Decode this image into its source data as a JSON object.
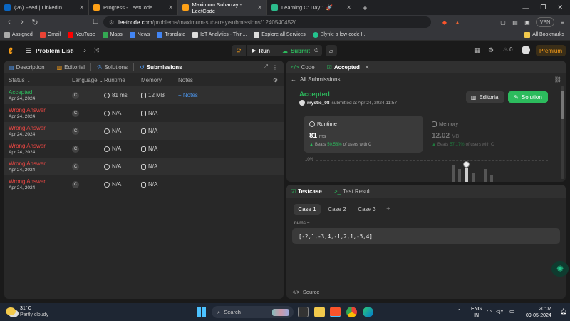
{
  "browser": {
    "tabs": [
      {
        "title": "(26) Feed | LinkedIn",
        "color": "#0a66c2"
      },
      {
        "title": "Progress - LeetCode",
        "color": "#ffa116"
      },
      {
        "title": "Maximum Subarray - LeetCode",
        "color": "#ffa116",
        "active": true
      },
      {
        "title": "Learning C: Day 1 🚀",
        "color": "#2cbb8c"
      }
    ],
    "url_host": "leetcode.com",
    "url_path": "/problems/maximum-subarray/submissions/1240540452/",
    "vpn_label": "VPN",
    "bookmarks": [
      {
        "label": "Assigned",
        "color": "#aaa"
      },
      {
        "label": "Gmail",
        "color": "#ea4335"
      },
      {
        "label": "YouTube",
        "color": "#ff0000"
      },
      {
        "label": "Maps",
        "color": "#34a853"
      },
      {
        "label": "News",
        "color": "#4285f4"
      },
      {
        "label": "Translate",
        "color": "#4285f4"
      },
      {
        "label": "IoT Analytics - Thin...",
        "color": "#ddd"
      },
      {
        "label": "Explore all Services",
        "color": "#ddd"
      },
      {
        "label": "Blynk: a low-code I...",
        "color": "#23c48e"
      }
    ],
    "all_bookmarks": "All Bookmarks"
  },
  "lc_header": {
    "problem_list": "Problem List",
    "run": "Run",
    "submit": "Submit",
    "streak": "0",
    "premium": "Premium"
  },
  "left_panel": {
    "tabs": [
      "Description",
      "Editorial",
      "Solutions",
      "Submissions"
    ],
    "columns": [
      "Status",
      "Language",
      "Runtime",
      "Memory",
      "Notes"
    ],
    "rows": [
      {
        "status": "Accepted",
        "date": "Apr 24, 2024",
        "lang": "C",
        "runtime": "81 ms",
        "memory": "12 MB",
        "notes": "+ Notes",
        "ok": true
      },
      {
        "status": "Wrong Answer",
        "date": "Apr 24, 2024",
        "lang": "C",
        "runtime": "N/A",
        "memory": "N/A",
        "notes": "",
        "ok": false
      },
      {
        "status": "Wrong Answer",
        "date": "Apr 24, 2024",
        "lang": "C",
        "runtime": "N/A",
        "memory": "N/A",
        "notes": "",
        "ok": false
      },
      {
        "status": "Wrong Answer",
        "date": "Apr 24, 2024",
        "lang": "C",
        "runtime": "N/A",
        "memory": "N/A",
        "notes": "",
        "ok": false
      },
      {
        "status": "Wrong Answer",
        "date": "Apr 24, 2024",
        "lang": "C",
        "runtime": "N/A",
        "memory": "N/A",
        "notes": "",
        "ok": false
      },
      {
        "status": "Wrong Answer",
        "date": "Apr 24, 2024",
        "lang": "C",
        "runtime": "N/A",
        "memory": "N/A",
        "notes": "",
        "ok": false
      }
    ]
  },
  "right_top": {
    "tab_code": "Code",
    "tab_accepted": "Accepted",
    "all_submissions": "All Submissions",
    "status": "Accepted",
    "user": "mystic_08",
    "submitted": "submitted at Apr 24, 2024 11:57",
    "editorial_btn": "Editorial",
    "solution_btn": "Solution",
    "runtime_label": "Runtime",
    "runtime_value": "81",
    "runtime_unit": "ms",
    "runtime_beats_prefix": "Beats",
    "runtime_beats": "50.58%",
    "runtime_beats_suffix": "of users with C",
    "memory_label": "Memory",
    "memory_value": "12.02",
    "memory_unit": "MB",
    "memory_beats_prefix": "Beats",
    "memory_beats": "57.17%",
    "memory_beats_suffix": "of users with C",
    "chart_tick": "10%"
  },
  "right_bottom": {
    "tab_testcase": "Testcase",
    "tab_result": "Test Result",
    "cases": [
      "Case 1",
      "Case 2",
      "Case 3"
    ],
    "param_label": "nums =",
    "param_value": "[-2,1,-3,4,-1,2,1,-5,4]",
    "source": "Source"
  },
  "taskbar": {
    "temp": "31°C",
    "weather": "Partly cloudy",
    "search": "Search",
    "lang1": "ENG",
    "lang2": "IN",
    "time": "20:07",
    "date": "09-05-2024"
  }
}
